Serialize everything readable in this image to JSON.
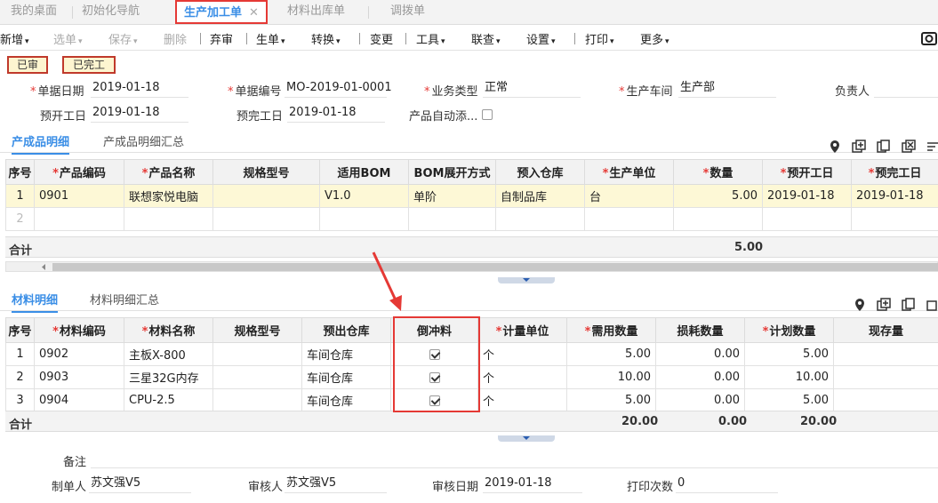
{
  "tabs": [
    {
      "label": "我的桌面"
    },
    {
      "label": "初始化导航"
    },
    {
      "label": "生产加工单",
      "close": "✕"
    },
    {
      "label": "材料出库单"
    },
    {
      "label": "调拨单"
    }
  ],
  "toolbar": {
    "new": "新增",
    "select": "选单",
    "save": "保存",
    "delete": "删除",
    "abandon": "弃审",
    "generate": "生单",
    "convert": "转换",
    "change": "变更",
    "tools": "工具",
    "query": "联查",
    "settings": "设置",
    "print": "打印",
    "more": "更多",
    "caret": "▾"
  },
  "status": {
    "audited": "已审",
    "completed": "已完工"
  },
  "header": {
    "bill_date_label": "单据日期",
    "bill_date": "2019-01-18",
    "bill_no_label": "单据编号",
    "bill_no": "MO-2019-01-0001",
    "biz_type_label": "业务类型",
    "biz_type": "正常",
    "workshop_label": "生产车间",
    "workshop": "生产部",
    "owner_label": "负责人",
    "owner": "",
    "start_label": "预开工日",
    "start": "2019-01-18",
    "finish_label": "预完工日",
    "finish": "2019-01-18",
    "auto_label": "产品自动添..."
  },
  "product_section": {
    "tab_active": "产成品明细",
    "tab_other": "产成品明细汇总",
    "columns": [
      "序号",
      "产品编码",
      "产品名称",
      "规格型号",
      "适用BOM",
      "BOM展开方式",
      "预入仓库",
      "生产单位",
      "数量",
      "预开工日",
      "预完工日"
    ],
    "rows": [
      {
        "no": "1",
        "code": "0901",
        "name": "联想家悦电脑",
        "spec": "",
        "bom": "V1.0",
        "expand": "单阶",
        "wh": "自制品库",
        "unit": "台",
        "qty": "5.00",
        "start": "2019-01-18",
        "finish": "2019-01-18"
      },
      {
        "no": "2",
        "code": "",
        "name": "",
        "spec": "",
        "bom": "",
        "expand": "",
        "wh": "",
        "unit": "",
        "qty": "",
        "start": "",
        "finish": ""
      }
    ],
    "total_label": "合计",
    "total_qty": "5.00"
  },
  "material_section": {
    "tab_active": "材料明细",
    "tab_other": "材料明细汇总",
    "columns": [
      "序号",
      "材料编码",
      "材料名称",
      "规格型号",
      "预出仓库",
      "倒冲料",
      "计量单位",
      "需用数量",
      "损耗数量",
      "计划数量",
      "现存量"
    ],
    "rows": [
      {
        "no": "1",
        "code": "0902",
        "name": "主板X-800",
        "spec": "",
        "wh": "车间仓库",
        "backflush": true,
        "unit": "个",
        "need": "5.00",
        "loss": "0.00",
        "plan": "5.00",
        "stock": ""
      },
      {
        "no": "2",
        "code": "0903",
        "name": "三星32G内存",
        "spec": "",
        "wh": "车间仓库",
        "backflush": true,
        "unit": "个",
        "need": "10.00",
        "loss": "0.00",
        "plan": "10.00",
        "stock": ""
      },
      {
        "no": "3",
        "code": "0904",
        "name": "CPU-2.5",
        "spec": "",
        "wh": "车间仓库",
        "backflush": true,
        "unit": "个",
        "need": "5.00",
        "loss": "0.00",
        "plan": "5.00",
        "stock": ""
      }
    ],
    "total_label": "合计",
    "total_need": "20.00",
    "total_loss": "0.00",
    "total_plan": "20.00"
  },
  "footer": {
    "remark_label": "备注",
    "remark": "",
    "maker_label": "制单人",
    "maker": "苏文强V5",
    "auditor_label": "审核人",
    "auditor": "苏文强V5",
    "audit_date_label": "审核日期",
    "audit_date": "2019-01-18",
    "print_count_label": "打印次数",
    "print_count": "0"
  },
  "colors": {
    "accent": "#3a8ee6",
    "highlight_border": "#e53935",
    "selected_row": "#fdf8d6",
    "badge_bg": "#fdf5d0"
  }
}
